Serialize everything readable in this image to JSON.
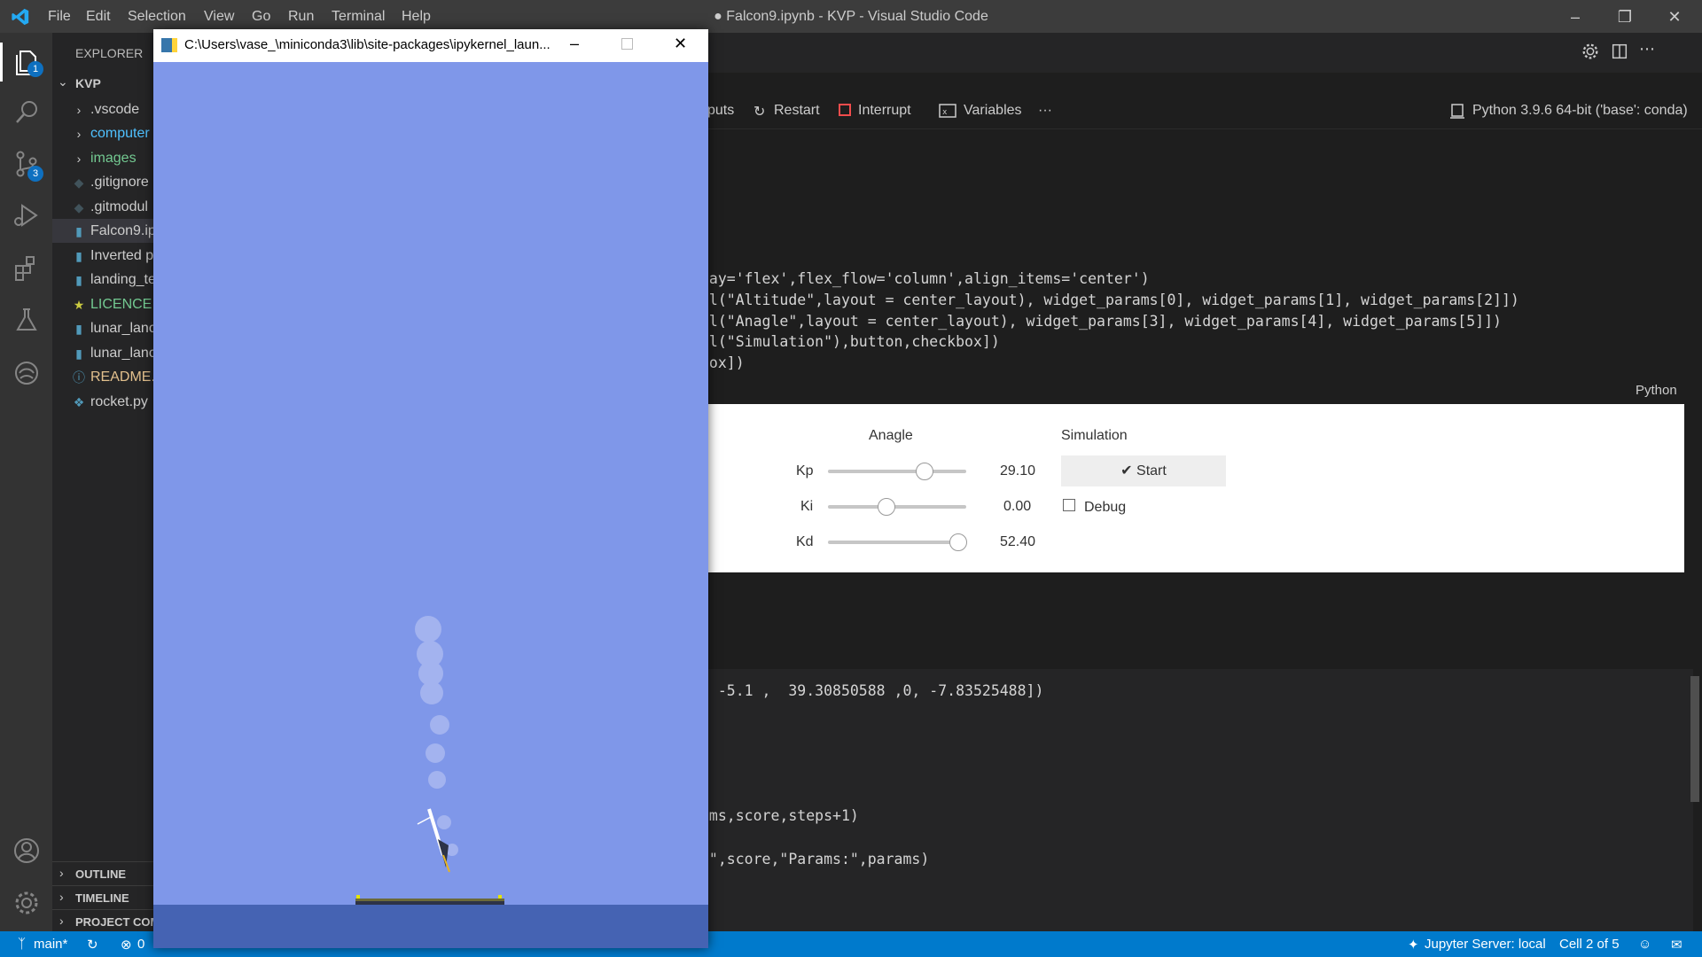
{
  "window": {
    "title": "● Falcon9.ipynb - KVP - Visual Studio Code",
    "menu": [
      "File",
      "Edit",
      "Selection",
      "View",
      "Go",
      "Run",
      "Terminal",
      "Help"
    ]
  },
  "activity": {
    "explorer_badge": "1",
    "scm_badge": "3"
  },
  "sidebar": {
    "header": "EXPLORER",
    "root": "KVP",
    "items": [
      {
        "label": ".vscode",
        "kind": "folder"
      },
      {
        "label": "computer",
        "kind": "folder"
      },
      {
        "label": "images",
        "kind": "folder"
      },
      {
        "label": ".gitignore",
        "kind": "file"
      },
      {
        "label": ".gitmodul",
        "kind": "file"
      },
      {
        "label": "Falcon9.ip",
        "kind": "notebook"
      },
      {
        "label": "Inverted p",
        "kind": "notebook"
      },
      {
        "label": "landing_te",
        "kind": "notebook"
      },
      {
        "label": "LICENCE",
        "kind": "license"
      },
      {
        "label": "lunar_lanc",
        "kind": "notebook"
      },
      {
        "label": "lunar_lanc",
        "kind": "notebook"
      },
      {
        "label": "README.r",
        "kind": "info"
      },
      {
        "label": "rocket.py",
        "kind": "python"
      }
    ],
    "sections": [
      "OUTLINE",
      "TIMELINE",
      "PROJECT COM"
    ]
  },
  "toolbar": {
    "outputs_partial": "puts",
    "restart": "Restart",
    "interrupt": "Interrupt",
    "variables": "Variables",
    "more": "···",
    "kernel": "Python 3.9.6 64-bit ('base': conda)"
  },
  "code_cell1": {
    "lines": [
      "lay='flex',flex_flow='column',align_items='center')",
      "el(\"Altitude\",layout = center_layout), widget_params[0], widget_params[1], widget_params[2]])",
      "el(\"Anagle\",layout = center_layout), widget_params[3], widget_params[4], widget_params[5]])",
      "el(\"Simulation\"),button,checkbox])",
      "box])"
    ],
    "language": "Python"
  },
  "widget": {
    "angle_title": "Anagle",
    "simulation_title": "Simulation",
    "params": [
      {
        "label": "Kp",
        "value": "29.10",
        "fraction": 0.7
      },
      {
        "label": "Ki",
        "value": "0.00",
        "fraction": 0.42
      },
      {
        "label": "Kd",
        "value": "52.40",
        "fraction": 0.94
      }
    ],
    "start_label": "✔ Start",
    "debug_label": "Debug"
  },
  "code_cell2": {
    "lines": [
      ", -5.1 ,  39.30850588 ,0, -7.83525488])",
      "ams,score,steps+1)",
      ":\",score,\"Params:\",params)"
    ]
  },
  "popup": {
    "title": "C:\\Users\\vase_\\miniconda3\\lib\\site-packages\\ipykernel_laun..."
  },
  "statusbar": {
    "branch": "main*",
    "errors": "0",
    "jupyter": "Jupyter Server: local",
    "cell": "Cell 2 of 5"
  },
  "colors": {
    "accent": "#007acc",
    "sky": "#7f97e9",
    "ground": "#4563b3"
  }
}
